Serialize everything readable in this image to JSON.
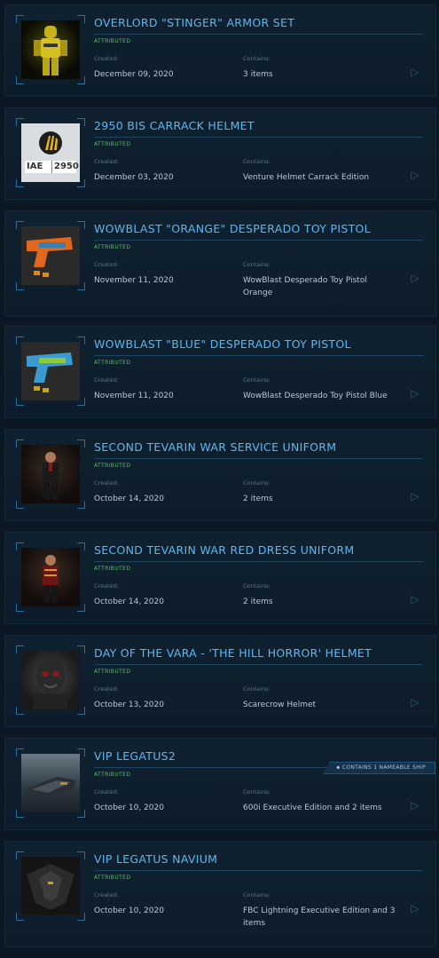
{
  "labels": {
    "created": "Created:",
    "contains": "Contains:"
  },
  "items": [
    {
      "title": "OVERLORD \"STINGER\" ARMOR SET",
      "status": "ATTRIBUTED",
      "created": "December 09, 2020",
      "contains": "3 items"
    },
    {
      "title": "2950 BIS CARRACK HELMET",
      "status": "ATTRIBUTED",
      "created": "December 03, 2020",
      "contains": "Venture Helmet Carrack Edition",
      "thumb_text_left": "IAE",
      "thumb_text_right": "2950"
    },
    {
      "title": "WOWBLAST \"ORANGE\" DESPERADO TOY PISTOL",
      "status": "ATTRIBUTED",
      "created": "November 11, 2020",
      "contains": "WowBlast Desperado Toy Pistol Orange"
    },
    {
      "title": "WOWBLAST \"BLUE\" DESPERADO TOY PISTOL",
      "status": "ATTRIBUTED",
      "created": "November 11, 2020",
      "contains": "WowBlast Desperado Toy Pistol Blue"
    },
    {
      "title": "SECOND TEVARIN WAR SERVICE UNIFORM",
      "status": "ATTRIBUTED",
      "created": "October 14, 2020",
      "contains": "2 items"
    },
    {
      "title": "SECOND TEVARIN WAR RED DRESS UNIFORM",
      "status": "ATTRIBUTED",
      "created": "October 14, 2020",
      "contains": "2 items"
    },
    {
      "title": "DAY OF THE VARA - 'THE HILL HORROR' HELMET",
      "status": "ATTRIBUTED",
      "created": "October 13, 2020",
      "contains": "Scarecrow Helmet"
    },
    {
      "title": "VIP LEGATUS2",
      "status": "ATTRIBUTED",
      "created": "October 10, 2020",
      "contains": "600i Executive Edition and 2 items",
      "badge": "CONTAINS 1 NAMEABLE SHIP"
    },
    {
      "title": "VIP LEGATUS NAVIUM",
      "status": "ATTRIBUTED",
      "created": "October 10, 2020",
      "contains": "FBC Lightning Executive Edition and 3 items"
    }
  ],
  "colors": {
    "title": "#5db7ef",
    "status": "#3fd33f",
    "background": "#0b1722"
  }
}
